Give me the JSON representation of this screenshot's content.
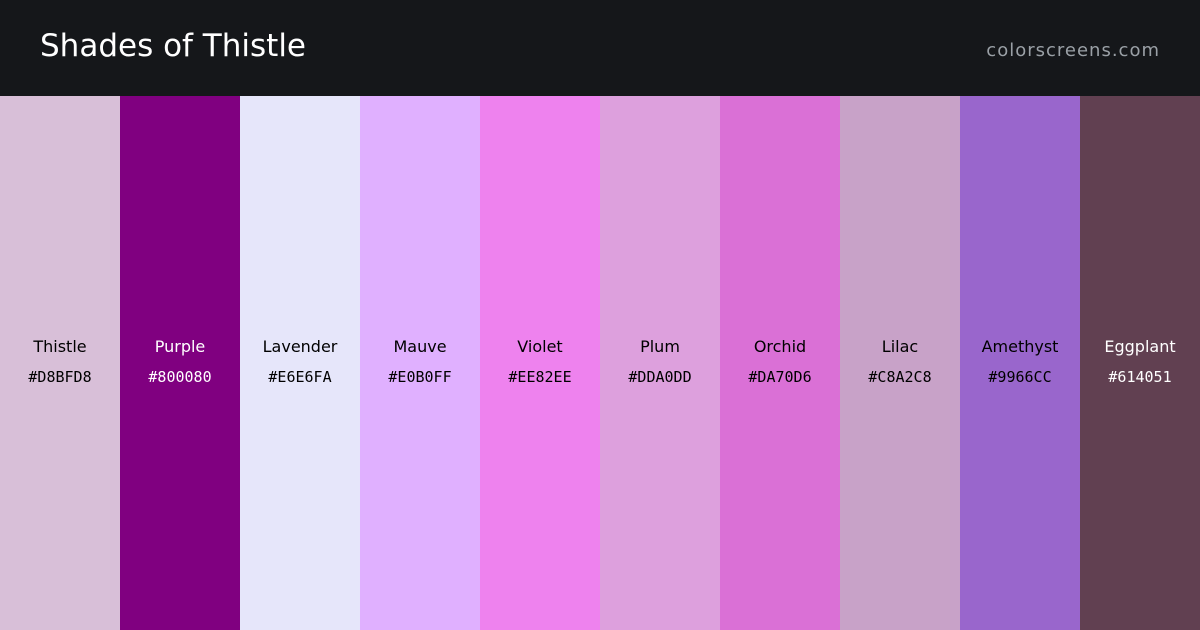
{
  "header": {
    "title": "Shades of Thistle",
    "site": "colorscreens.com"
  },
  "swatches": [
    {
      "name": "Thistle",
      "hex": "#D8BFD8",
      "color": "#D8BFD8",
      "text_color": "#000000"
    },
    {
      "name": "Purple",
      "hex": "#800080",
      "color": "#800080",
      "text_color": "#FFFFFF"
    },
    {
      "name": "Lavender",
      "hex": "#E6E6FA",
      "color": "#E6E6FA",
      "text_color": "#000000"
    },
    {
      "name": "Mauve",
      "hex": "#E0B0FF",
      "color": "#E0B0FF",
      "text_color": "#000000"
    },
    {
      "name": "Violet",
      "hex": "#EE82EE",
      "color": "#EE82EE",
      "text_color": "#000000"
    },
    {
      "name": "Plum",
      "hex": "#DDA0DD",
      "color": "#DDA0DD",
      "text_color": "#000000"
    },
    {
      "name": "Orchid",
      "hex": "#DA70D6",
      "color": "#DA70D6",
      "text_color": "#000000"
    },
    {
      "name": "Lilac",
      "hex": "#C8A2C8",
      "color": "#C8A2C8",
      "text_color": "#000000"
    },
    {
      "name": "Amethyst",
      "hex": "#9966CC",
      "color": "#9966CC",
      "text_color": "#000000"
    },
    {
      "name": "Eggplant",
      "hex": "#614051",
      "color": "#614051",
      "text_color": "#FFFFFF"
    }
  ]
}
